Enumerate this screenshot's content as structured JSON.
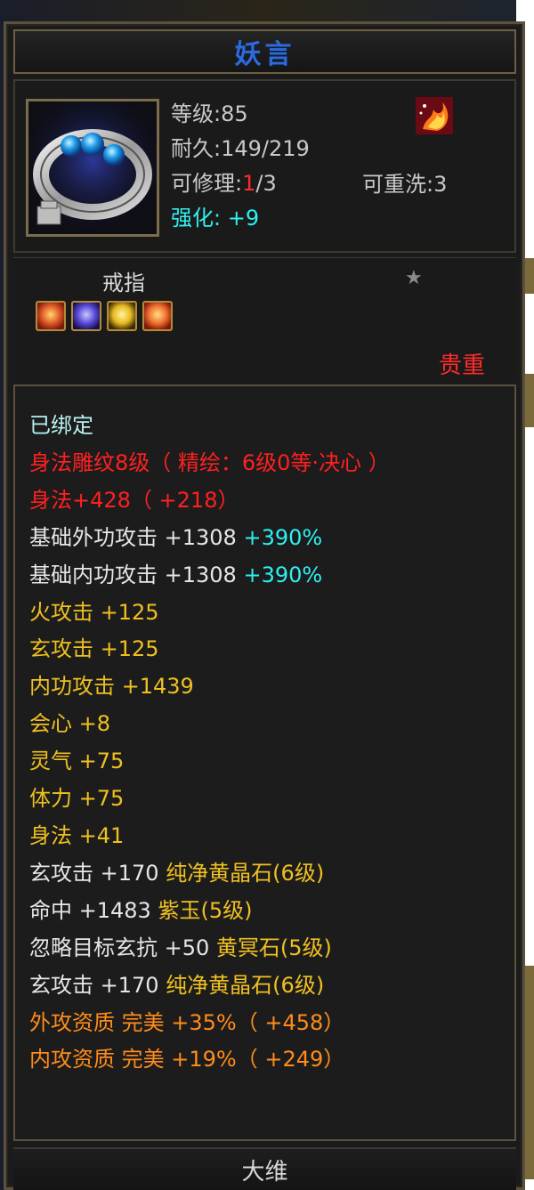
{
  "item": {
    "name": "妖言",
    "level_label": "等级:85",
    "durability_label": "耐久:149/219",
    "repair_prefix": "可修理:",
    "repair_used": "1",
    "repair_total": "/3",
    "reroll_label": "可重洗:3",
    "enhance_label": "强化: +9",
    "type": "戒指",
    "rarity": "贵重",
    "bound": "已绑定"
  },
  "icons": {
    "item": "silver-ring-blue-gems-icon",
    "fire": "fire-phoenix-icon",
    "star": "star-icon",
    "gems": [
      "orange-gem-icon",
      "purple-gem-icon",
      "yellow-gem-icon",
      "orange-gem-icon"
    ]
  },
  "attributes": [
    {
      "segments": [
        {
          "text": "身法雕纹8级（ 精绘：6级0等·决心 ）",
          "color": "red"
        }
      ]
    },
    {
      "segments": [
        {
          "text": "身法+428（ +218）",
          "color": "red"
        }
      ]
    },
    {
      "segments": [
        {
          "text": "基础外功攻击 +1308 ",
          "color": "white"
        },
        {
          "text": "+390%",
          "color": "cyan"
        }
      ]
    },
    {
      "segments": [
        {
          "text": "基础内功攻击 +1308 ",
          "color": "white"
        },
        {
          "text": "+390%",
          "color": "cyan"
        }
      ]
    },
    {
      "segments": [
        {
          "text": "火攻击 +125",
          "color": "gold"
        }
      ]
    },
    {
      "segments": [
        {
          "text": "玄攻击 +125",
          "color": "gold"
        }
      ]
    },
    {
      "segments": [
        {
          "text": "内功攻击 +1439",
          "color": "gold"
        }
      ]
    },
    {
      "segments": [
        {
          "text": "会心 +8",
          "color": "gold"
        }
      ]
    },
    {
      "segments": [
        {
          "text": "灵气 +75",
          "color": "gold"
        }
      ]
    },
    {
      "segments": [
        {
          "text": "体力 +75",
          "color": "gold"
        }
      ]
    },
    {
      "segments": [
        {
          "text": "身法 +41",
          "color": "gold"
        }
      ]
    },
    {
      "segments": [
        {
          "text": "玄攻击 +170 ",
          "color": "white"
        },
        {
          "text": "纯净黄晶石(6级)",
          "color": "gold"
        }
      ]
    },
    {
      "segments": [
        {
          "text": "命中 +1483 ",
          "color": "white"
        },
        {
          "text": "紫玉(5级)",
          "color": "gold"
        }
      ]
    },
    {
      "segments": [
        {
          "text": "忽略目标玄抗 +50 ",
          "color": "white"
        },
        {
          "text": "黄冥石(5级)",
          "color": "gold"
        }
      ]
    },
    {
      "segments": [
        {
          "text": "玄攻击 +170 ",
          "color": "white"
        },
        {
          "text": "纯净黄晶石(6级)",
          "color": "gold"
        }
      ]
    },
    {
      "segments": [
        {
          "text": "外攻资质  完美 +35%（ +458）",
          "color": "orange"
        }
      ]
    },
    {
      "segments": [
        {
          "text": "内攻资质  完美 +19%（ +249）",
          "color": "orange"
        }
      ]
    }
  ],
  "footer": {
    "label": "大维"
  },
  "colors": {
    "title": "#2f6bd8",
    "red": "#ff2020",
    "gold": "#f0c020",
    "orange": "#ff8c1a",
    "cyan": "#2ef0f0",
    "white": "#e6e6e6"
  }
}
